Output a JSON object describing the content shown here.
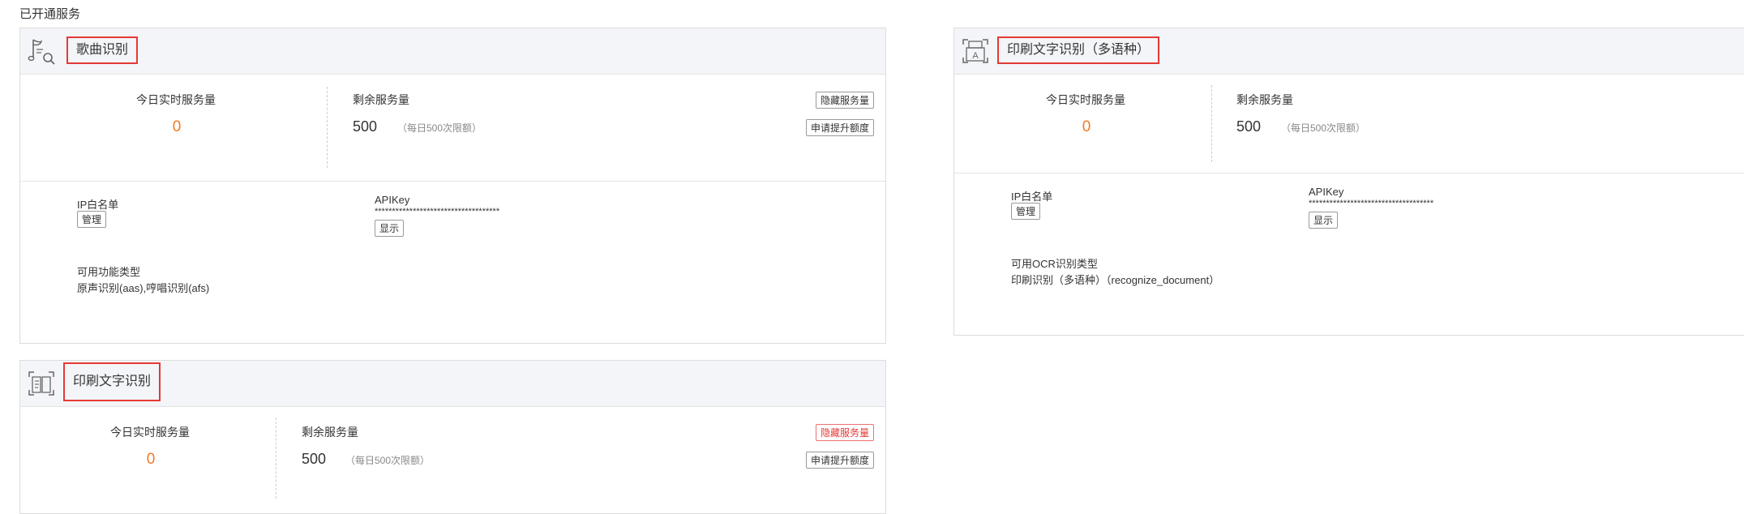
{
  "section_title": "已开通服务",
  "stats_labels": {
    "today_realtime": "今日实时服务量",
    "remaining": "剩余服务量"
  },
  "common": {
    "ip_whitelist": "IP白名单",
    "manage": "管理",
    "apikey": "APIKey",
    "apikey_mask": "************************************",
    "show": "显示",
    "hide_service": "隐藏服务量",
    "apply_quota": "申请提升额度"
  },
  "cards": [
    {
      "title": "歌曲识别",
      "icon": "music-search-icon",
      "today": "0",
      "remaining": "500",
      "quota_note": "（每日500次限额）",
      "features_label": "可用功能类型",
      "features": "原声识别(aas),哼唱识别(afs)"
    },
    {
      "title": "印刷文字识别（多语种）",
      "icon": "print-ocr-icon",
      "today": "0",
      "remaining": "500",
      "quota_note": "（每日500次限额）",
      "features_label": "可用OCR识别类型",
      "features": "印刷识别（多语种）（recognize_document）"
    },
    {
      "title": "印刷文字识别",
      "icon": "document-scan-icon",
      "today": "0",
      "remaining": "500",
      "quota_note": "（每日500次限额）"
    }
  ],
  "colors": {
    "accent_orange": "#ee7b27",
    "highlight_red": "#e53935",
    "header_bg": "#f3f5f8"
  }
}
